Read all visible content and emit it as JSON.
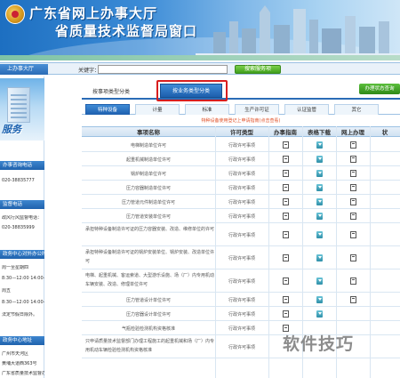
{
  "banner": {
    "title_line1": "广东省网上办事大厅",
    "title_line2": "省质量技术监督局窗口"
  },
  "searchbar": {
    "left_tab": "上办事大厅",
    "keyword_label": "关键字：",
    "search_value": "",
    "search_button": "搜索服务项"
  },
  "sidebar": {
    "photo_label": "服务",
    "sections": [
      {
        "heading": "办事咨询电话",
        "lines": [
          "020-38835777"
        ]
      },
      {
        "heading": "监督电话",
        "lines": [
          "政风行风监督电话：",
          "020-38835999"
        ]
      },
      {
        "heading": "政务中心对外办公时间",
        "lines": [
          "周一至星期四",
          "8:30—12:00  14:00—17:30",
          "周五",
          "8:30—12:00  14:00—16:00",
          "法定节假日除外。"
        ]
      },
      {
        "heading": "政务中心地址",
        "lines": [
          "广州市天河区",
          "黄埔大道西363号",
          "广东省质量技术监督办公大楼"
        ]
      }
    ]
  },
  "main": {
    "tab_by_item": "按事项类型分类",
    "tab_by_service": "按业务类型分类",
    "tab_right": "办理状态查询",
    "categories": [
      "特种设备",
      "计量",
      "标准",
      "生产许可证",
      "认证监管",
      "其它"
    ],
    "active_category": "特种设备",
    "notice": "特种设备使用登记上申请指南(点击查看)",
    "columns": [
      "事项名称",
      "许可类型",
      "办事指南",
      "表格下载",
      "网上办理",
      "状"
    ],
    "rows": [
      {
        "name": "电梯制造单位许可",
        "type": "行政许可事项"
      },
      {
        "name": "起重机械制造单位许可",
        "type": "行政许可事项"
      },
      {
        "name": "锅炉制造单位许可",
        "type": "行政许可事项"
      },
      {
        "name": "压力容器制造单位许可",
        "type": "行政许可事项"
      },
      {
        "name": "压力管道元件制造单位许可",
        "type": "行政许可事项"
      },
      {
        "name": "压力管道安装单位许可",
        "type": "行政许可事项"
      },
      {
        "name": "承担特种设备制造许可证的压力容器安装、改造、维修单位的许可",
        "type": "行政许可事项"
      },
      {
        "name": "承担特种设备制造许可证的锅炉安装单位、锅炉安装、改造单位许可",
        "type": "行政许可事项"
      },
      {
        "name": "电梯、起重机械、客运索道、大型游乐设施、场（厂）内专用机动车辆安装、改造、修理单位许可",
        "type": "行政许可事项"
      },
      {
        "name": "压力管道设计单位许可",
        "type": "行政许可事项"
      },
      {
        "name": "压力容器设计单位许可",
        "type": "行政许可事项"
      },
      {
        "name": "气瓶检验检测机构资格核准",
        "type": "行政许可事项"
      },
      {
        "name": "只申请质量技术监督部门办理工程施工的起重机械和场（厂）内专用机动车辆检验检测机构资格核准",
        "type": "行政许可事项"
      }
    ]
  },
  "watermark": "软件技巧"
}
